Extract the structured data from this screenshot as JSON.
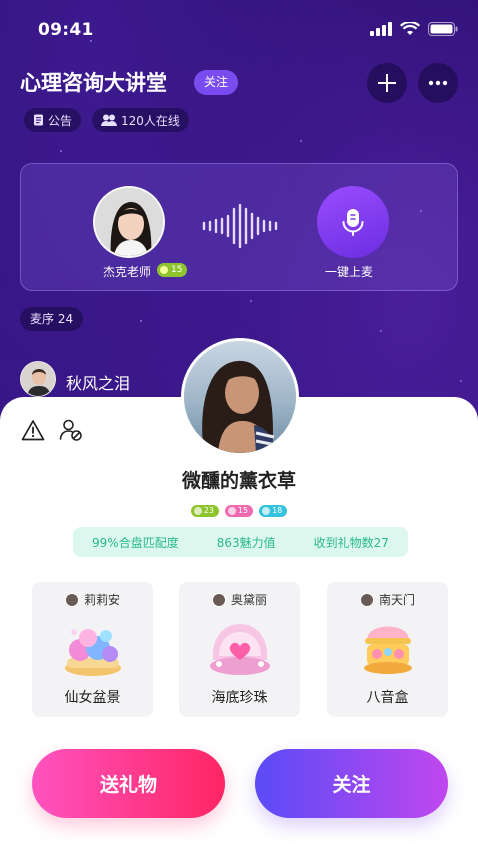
{
  "status_bar": {
    "time": "09:41"
  },
  "room": {
    "title": "心理咨询大讲堂",
    "follow_label": "关注",
    "notice_label": "公告",
    "online_label": "120人在线"
  },
  "host": {
    "name": "杰克老师",
    "level": "15",
    "mic_label": "一键上麦"
  },
  "queue": {
    "label": "麦序 24"
  },
  "list_user": {
    "name": "秋风之泪"
  },
  "profile": {
    "name": "微醺的薰衣草",
    "badges": [
      {
        "value": "23",
        "color": "#8ec42d"
      },
      {
        "value": "15",
        "color": "#f06ab0"
      },
      {
        "value": "18",
        "color": "#33c3dc"
      }
    ],
    "stats": [
      "99%合盘匹配度",
      "863魅力值",
      "收到礼物数27"
    ]
  },
  "gifts": [
    {
      "sender": "莉莉安",
      "name": "仙女盆景"
    },
    {
      "sender": "奥黛丽",
      "name": "海底珍珠"
    },
    {
      "sender": "南天门",
      "name": "八音盒"
    }
  ],
  "actions": {
    "send_gift": "送礼物",
    "follow": "关注"
  },
  "colors": {
    "bg": "#2b0f70",
    "accent_purple": "#7a4cf0",
    "stats_bg": "#dcf8ee",
    "stats_text": "#2ab98a",
    "gift_btn": "#ff2563",
    "follow_btn": "#5a4bf7"
  }
}
